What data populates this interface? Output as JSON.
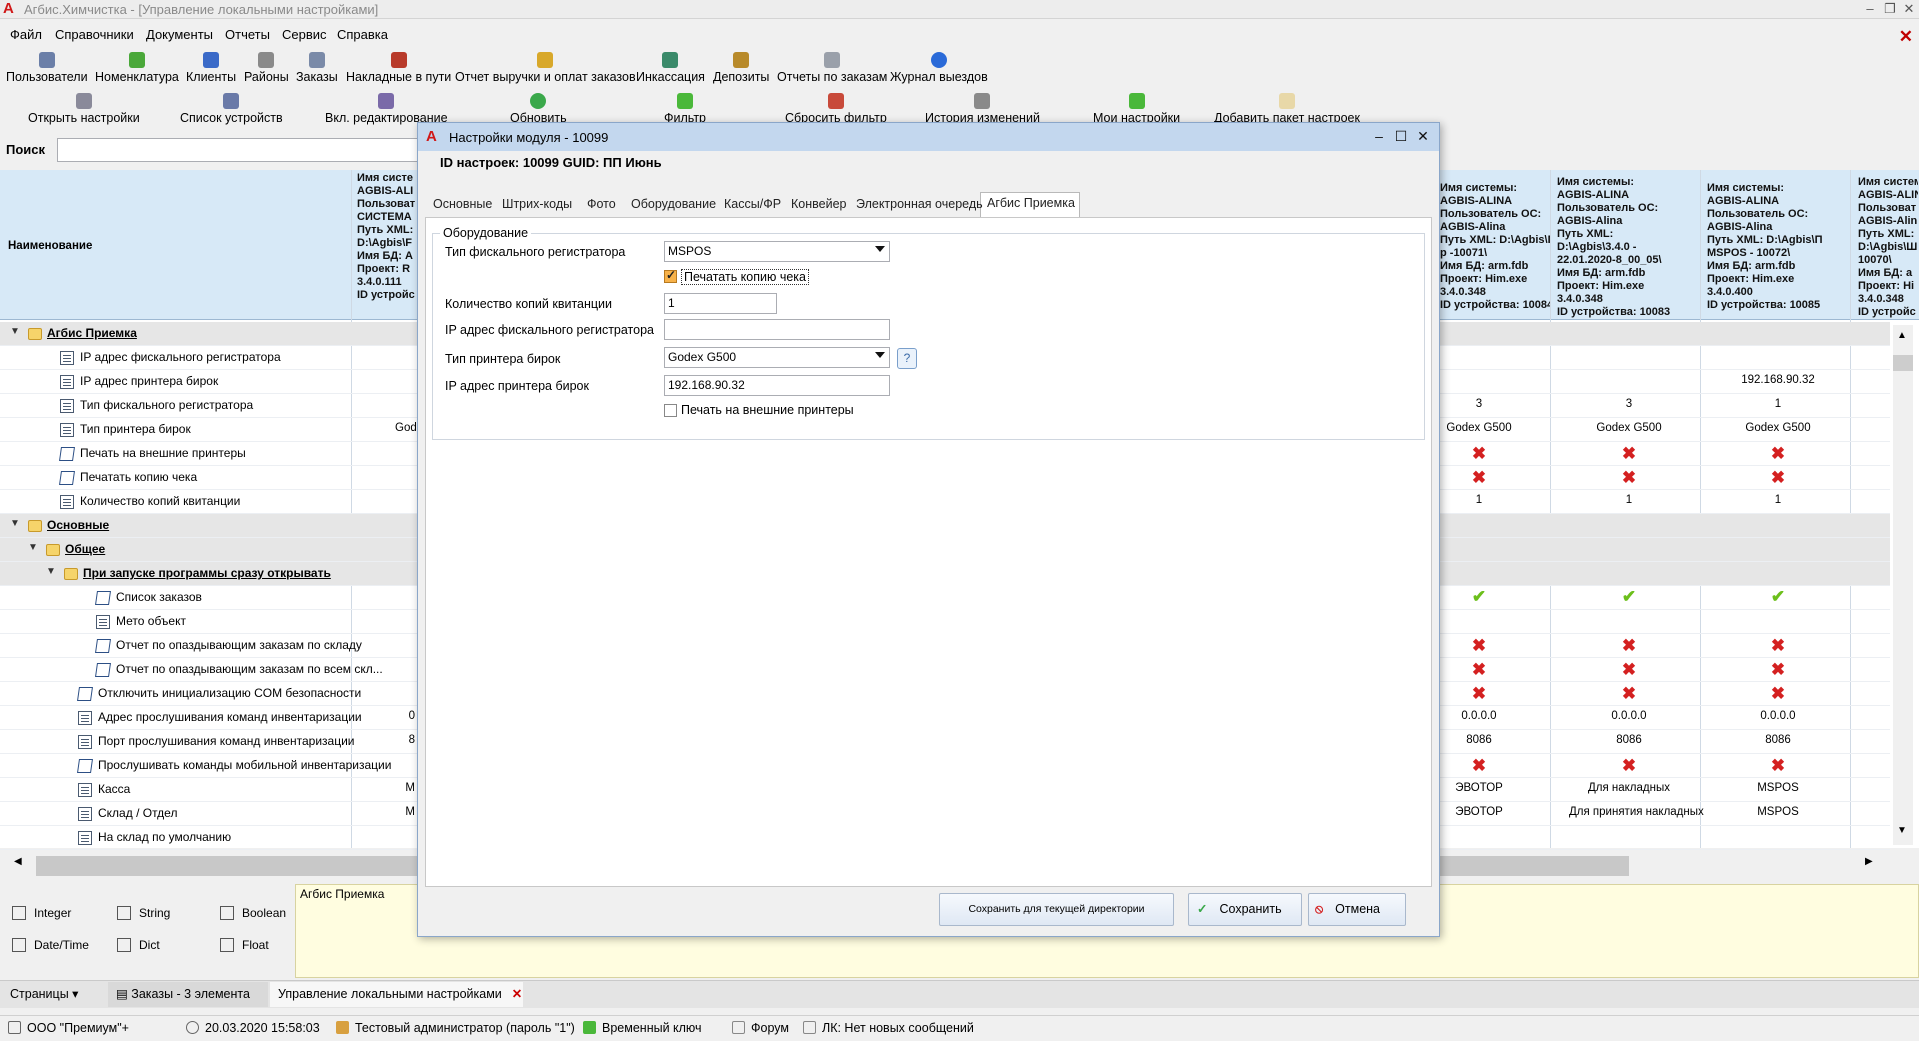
{
  "window": {
    "title": "Агбис.Химчистка - [Управление локальными настройками]",
    "logo": "A",
    "btn_minimize": "–",
    "btn_restore": "❐",
    "btn_close": "✕",
    "app_close": "✕"
  },
  "menu": [
    "Файл",
    "Справочники",
    "Документы",
    "Отчеты",
    "Сервис",
    "Справка"
  ],
  "toolbar1": [
    {
      "label": "Пользователи",
      "icon": "users-icon",
      "color": "#6b7fa8"
    },
    {
      "label": "Номенклатура",
      "icon": "nomenclature-icon",
      "color": "#4aa83a"
    },
    {
      "label": "Клиенты",
      "icon": "clients-icon",
      "color": "#3a6ac8"
    },
    {
      "label": "Районы",
      "icon": "districts-icon",
      "color": "#8a8a8a"
    },
    {
      "label": "Заказы",
      "icon": "orders-icon",
      "color": "#7a8aa8"
    },
    {
      "label": "Накладные в пути",
      "icon": "truck-icon",
      "color": "#b83a2a"
    },
    {
      "label": "Отчет выручки и оплат заказов",
      "icon": "revenue-icon",
      "color": "#d8a82a"
    },
    {
      "label": "Инкассация",
      "icon": "collection-icon",
      "color": "#3a8a6a"
    },
    {
      "label": "Депозиты",
      "icon": "deposits-icon",
      "color": "#b88a2a"
    },
    {
      "label": "Отчеты по заказам",
      "icon": "order-reports-icon",
      "color": "#9aa0aa"
    },
    {
      "label": "Журнал выездов",
      "icon": "trips-journal-icon",
      "color": "#2a6ad8"
    }
  ],
  "toolbar2": [
    {
      "label": "Открыть настройки",
      "icon": "open-settings-icon",
      "color": "#8a8a9a"
    },
    {
      "label": "Список устройств",
      "icon": "devices-list-icon",
      "color": "#6a7aa8"
    },
    {
      "label": "Вкл. редактирование",
      "icon": "edit-mode-icon",
      "color": "#7a6aa8"
    },
    {
      "label": "Обновить",
      "icon": "refresh-icon",
      "color": "#3aa84a"
    },
    {
      "label": "Фильтр",
      "icon": "filter-icon",
      "color": "#4ab83a"
    },
    {
      "label": "Сбросить фильтр",
      "icon": "reset-filter-icon",
      "color": "#c84a3a"
    },
    {
      "label": "История изменений",
      "icon": "history-icon",
      "color": "#8a8a8a"
    },
    {
      "label": "Мои настройки",
      "icon": "my-settings-icon",
      "color": "#4ab83a"
    },
    {
      "label": "Добавить пакет настроек",
      "icon": "add-package-icon",
      "color": "#e8d8a8"
    }
  ],
  "search": {
    "label": "Поиск",
    "value": ""
  },
  "grid": {
    "name_header": "Наименование",
    "col1_header": "Имя систе\nAGBIS-ALI\nПользоват\nСИСТЕМА\nПуть XML:\nD:\\Agbis\\F\nИмя БД: A\nПроект: R\n3.4.0.111\nID устройс",
    "col_a_header": "Имя системы:\nAGBIS-ALINA\nПользователь ОС:\nAGBIS-Alina\nПуть XML: D:\\Agbis\\П\nр -10071\\\nИмя БД: arm.fdb\nПроект: Him.exe\n3.4.0.348\nID устройства: 10084",
    "col_b_header": "Имя системы:\nAGBIS-ALINA\nПользователь ОС:\nAGBIS-Alina\nПуть XML:\nD:\\Agbis\\3.4.0 -\n22.01.2020-8_00_05\\\nИмя БД: arm.fdb\nПроект: Him.exe\n3.4.0.348\nID устройства: 10083",
    "col_c_header": "Имя системы:\nAGBIS-ALINA\nПользователь ОС:\nAGBIS-Alina\nПуть XML: D:\\Agbis\\П\nMSPOS - 10072\\\nИмя БД: arm.fdb\nПроект: Him.exe\n3.4.0.400\nID устройства: 10085",
    "col_d_header": "Имя системы:\nAGBIS-ALINA\nПользоват\nAGBIS-Alin\nПуть XML:\nD:\\Agbis\\Ш\n10070\\\nИмя БД: a\nПроект: Hi\n3.4.0.348\nID устройс",
    "rows": [
      {
        "name": "Агбис Приемка",
        "c1": "",
        "a": "",
        "b": "",
        "c": ""
      },
      {
        "name": "IP адрес фискального регистратора",
        "c1": "",
        "a": "",
        "b": "",
        "c": ""
      },
      {
        "name": "IP адрес принтера бирок",
        "c1": "",
        "a": "",
        "b": "",
        "c": "192.168.90.32"
      },
      {
        "name": "Тип фискального регистратора",
        "c1": "",
        "a": "3",
        "b": "3",
        "c": "1"
      },
      {
        "name": "Тип принтера бирок",
        "c1": "God",
        "a": "Godex G500",
        "b": "Godex G500",
        "c": "Godex G500"
      },
      {
        "name": "Печать на внешние принтеры",
        "c1": "",
        "a": "✖",
        "b": "✖",
        "c": "✖"
      },
      {
        "name": "Печатать копию чека",
        "c1": "",
        "a": "✖",
        "b": "✖",
        "c": "✖"
      },
      {
        "name": "Количество копий квитанции",
        "c1": "",
        "a": "1",
        "b": "1",
        "c": "1"
      },
      {
        "name": "Основные",
        "c1": "",
        "a": "",
        "b": "",
        "c": ""
      },
      {
        "name": "Общее",
        "c1": "",
        "a": "",
        "b": "",
        "c": ""
      },
      {
        "name": "При запуске программы сразу открывать",
        "c1": "",
        "a": "",
        "b": "",
        "c": ""
      },
      {
        "name": "Список заказов",
        "c1": "",
        "a": "✔",
        "b": "✔",
        "c": "✔"
      },
      {
        "name": "Мето объект",
        "c1": "",
        "a": "",
        "b": "",
        "c": ""
      },
      {
        "name": "Отчет по опаздывающим заказам по складу",
        "c1": "",
        "a": "✖",
        "b": "✖",
        "c": "✖"
      },
      {
        "name": "Отчет по опаздывающим заказам по всем скл...",
        "c1": "",
        "a": "✖",
        "b": "✖",
        "c": "✖"
      },
      {
        "name": "Отключить инициализацию COM безопасности",
        "c1": "",
        "a": "✖",
        "b": "✖",
        "c": "✖"
      },
      {
        "name": "Адрес прослушивания команд инвентаризации",
        "c1": "0",
        "a": "0.0.0.0",
        "b": "0.0.0.0",
        "c": "0.0.0.0"
      },
      {
        "name": "Порт прослушивания команд инвентаризации",
        "c1": "8",
        "a": "8086",
        "b": "8086",
        "c": "8086"
      },
      {
        "name": "Прослушивать команды мобильной инвентаризации",
        "c1": "",
        "a": "✖",
        "b": "✖",
        "c": "✖"
      },
      {
        "name": "Касса",
        "c1": "M",
        "a": "ЭВОТОР",
        "b": "Для накладных",
        "c": "MSPOS"
      },
      {
        "name": "Склад / Отдел",
        "c1": "M",
        "a": "ЭВОТОР",
        "b": "Для принятия накладных",
        "c": "MSPOS"
      },
      {
        "name": "На склад по умолчанию",
        "c1": "",
        "a": "",
        "b": "",
        "c": ""
      }
    ]
  },
  "types_legend": [
    {
      "label": "Integer",
      "icon": "integer-icon"
    },
    {
      "label": "String",
      "icon": "string-icon"
    },
    {
      "label": "Boolean",
      "icon": "boolean-icon"
    },
    {
      "label": "Date/Time",
      "icon": "datetime-icon"
    },
    {
      "label": "Dict",
      "icon": "dict-icon"
    },
    {
      "label": "Float",
      "icon": "float-icon"
    }
  ],
  "info_panel": {
    "text": "Агбис Приемка"
  },
  "page_tabs": {
    "pages_label": "Страницы",
    "tab1": "Заказы - 3 элемента",
    "tab2": "Управление локальными настройками",
    "tab2_close": "✕"
  },
  "status": {
    "company": "ООО \"Премиум\"+",
    "datetime": "20.03.2020 15:58:03",
    "user": "Тестовый администратор (пароль \"1\")",
    "key": "Временный ключ",
    "forum": "Форум",
    "messages": "ЛК: Нет новых сообщений"
  },
  "dialog": {
    "title": "Настройки модуля  - 10099",
    "id_line": "ID настроек: 10099   GUID: ПП Июнь",
    "tabs": [
      "Основные",
      "Штрих-коды",
      "Фото",
      "Оборудование",
      "Кассы/ФР",
      "Конвейер",
      "Электронная очередь",
      "Агбис Приемка"
    ],
    "group": "Оборудование",
    "fiscal_type_label": "Тип фискального регистратора",
    "fiscal_type_value": "MSPOS",
    "print_copy_label": "Печатать копию чека",
    "print_copy_checked": true,
    "copies_label": "Количество копий квитанции",
    "copies_value": "1",
    "fiscal_ip_label": "IP адрес фискального регистратора",
    "fiscal_ip_value": "",
    "printer_type_label": "Тип принтера бирок",
    "printer_type_value": "Godex G500",
    "help_glyph": "?",
    "printer_ip_label": "IP адрес принтера бирок",
    "printer_ip_value": "192.168.90.32",
    "external_print_label": "Печать на внешние принтеры",
    "external_print_checked": false,
    "btn_save_dir": "Сохранить для текущей директории",
    "btn_save": "Сохранить",
    "btn_cancel": "Отмена"
  }
}
